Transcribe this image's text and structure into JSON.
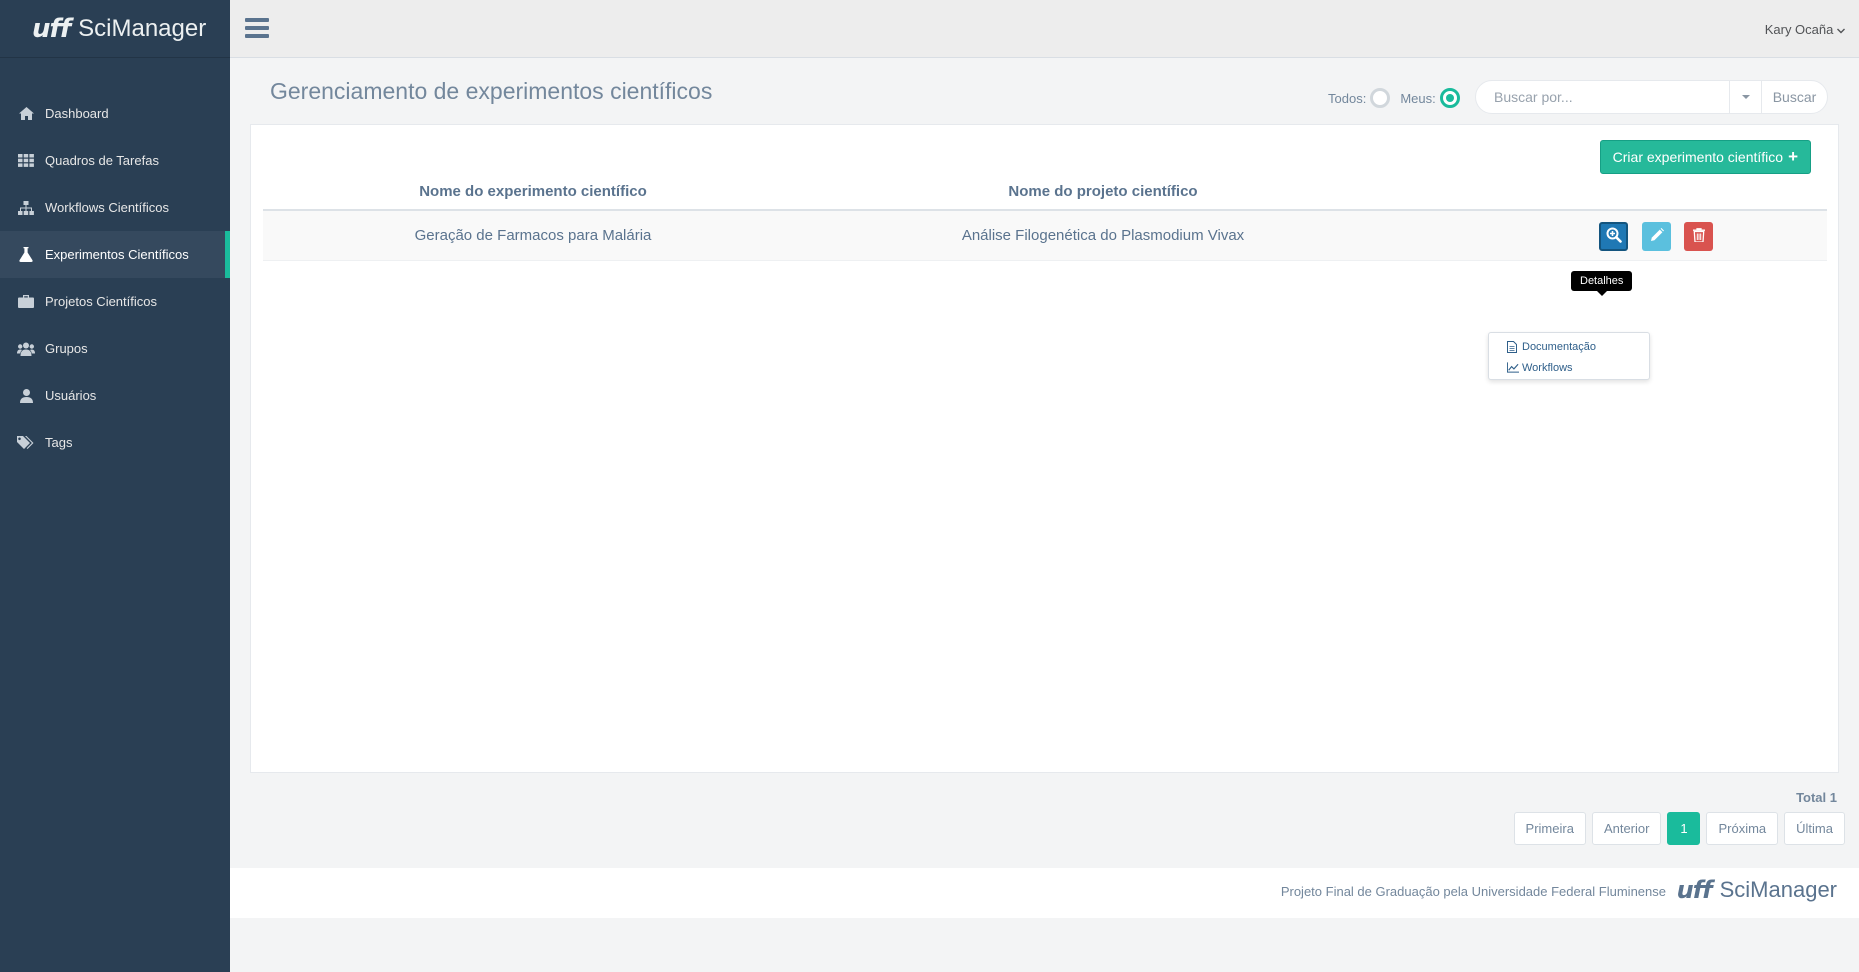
{
  "brand": {
    "logo_text": "uff",
    "name": "SciManager"
  },
  "sidebar": {
    "items": [
      {
        "label": "Dashboard",
        "icon": "home-icon"
      },
      {
        "label": "Quadros de Tarefas",
        "icon": "grid-icon"
      },
      {
        "label": "Workflows Científicos",
        "icon": "sitemap-icon"
      },
      {
        "label": "Experimentos Científicos",
        "icon": "flask-icon",
        "active": true
      },
      {
        "label": "Projetos Científicos",
        "icon": "briefcase-icon"
      },
      {
        "label": "Grupos",
        "icon": "users-icon"
      },
      {
        "label": "Usuários",
        "icon": "user-icon"
      },
      {
        "label": "Tags",
        "icon": "tags-icon"
      }
    ]
  },
  "header": {
    "user_name": "Kary Ocaña"
  },
  "main": {
    "title": "Gerenciamento de experimentos científicos",
    "filters": {
      "todos_label": "Todos:",
      "meus_label": "Meus:",
      "selected": "Meus"
    },
    "search": {
      "placeholder": "Buscar por...",
      "value": "",
      "button_label": "Buscar"
    },
    "create_button_label": "Criar experimento científico",
    "table": {
      "columns": [
        "Nome do experimento científico",
        "Nome do projeto científico"
      ],
      "rows": [
        {
          "experiment": "Geração de Farmacos para Malária",
          "project": "Análise Filogenética do Plasmodium Vivax"
        }
      ]
    },
    "tooltip": "Detalhes",
    "details_menu": [
      "Documentação",
      "Workflows"
    ],
    "total_label": "Total 1",
    "pagination": {
      "first": "Primeira",
      "prev": "Anterior",
      "current": "1",
      "next": "Próxima",
      "last": "Última"
    }
  },
  "footer": {
    "text": "Projeto Final de Graduação pela Universidade Federal Fluminense",
    "logo_text": "uff",
    "brand": "SciManager"
  },
  "colors": {
    "sidebar_bg": "#2a3f54",
    "accent": "#1abb9c",
    "create_button": "#26b99a",
    "view_button": "#1f78b4",
    "edit_button": "#5bc0de",
    "delete_button": "#d9534f"
  }
}
